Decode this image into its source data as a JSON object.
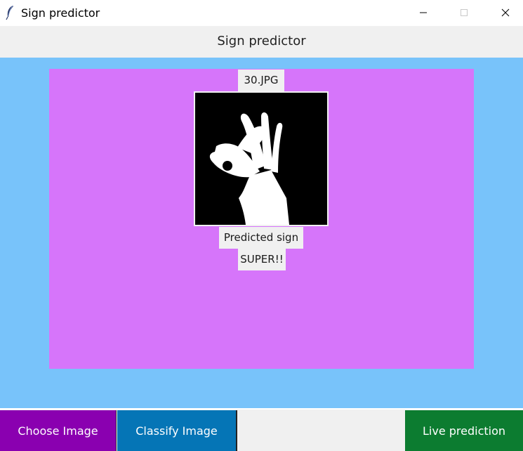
{
  "window": {
    "title": "Sign predictor",
    "icons": {
      "app": "feather-icon",
      "minimize": "minimize-icon",
      "maximize": "maximize-icon",
      "close": "close-icon"
    }
  },
  "header": {
    "title": "Sign predictor"
  },
  "colors": {
    "main_background": "#78c3fa",
    "panel": "#d675fa",
    "choose_button": "#8a00b0",
    "classify_button": "#0575b6",
    "live_button": "#0c7c30",
    "label_background": "#f0f0f0"
  },
  "image": {
    "filename": "30.JPG"
  },
  "prediction": {
    "title": "Predicted sign",
    "value": "SUPER!!"
  },
  "buttons": {
    "choose": "Choose Image",
    "classify": "Classify Image",
    "live": "Live prediction"
  }
}
